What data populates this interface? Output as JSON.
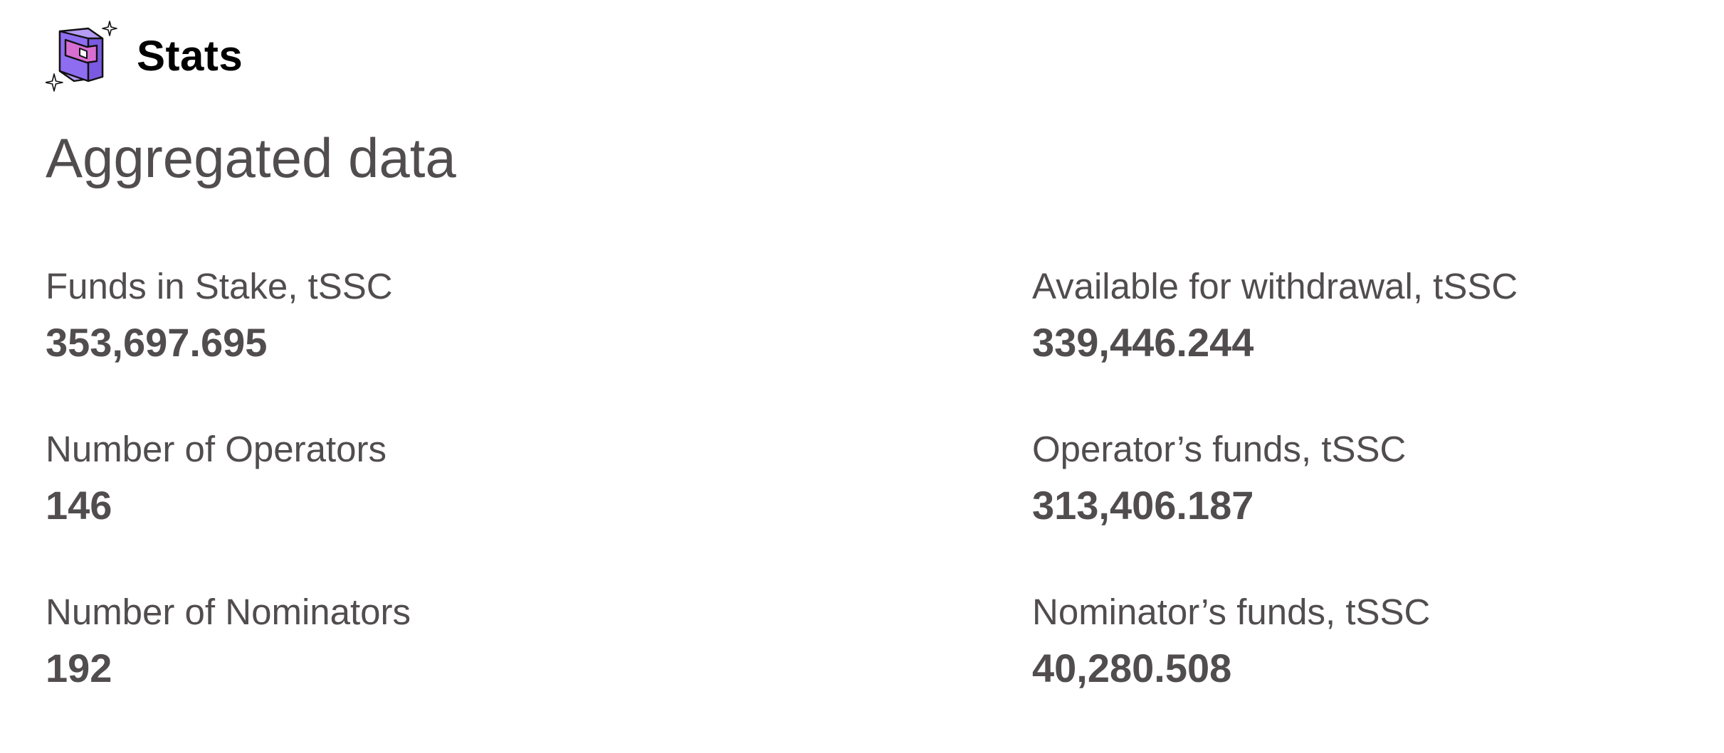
{
  "header": {
    "logo_icon": "wallet-icon",
    "title": "Stats"
  },
  "section": {
    "title": "Aggregated data"
  },
  "stats": [
    {
      "label": "Funds in Stake, tSSC",
      "value": "353,697.695"
    },
    {
      "label": "Available for withdrawal, tSSC",
      "value": "339,446.244"
    },
    {
      "label": "Number of Operators",
      "value": "146"
    },
    {
      "label": "Operator’s funds, tSSC",
      "value": "313,406.187"
    },
    {
      "label": "Number of Nominators",
      "value": "192"
    },
    {
      "label": "Nominator’s funds, tSSC",
      "value": "40,280.508"
    }
  ],
  "colors": {
    "text": "#514d4f",
    "title": "#000000",
    "logo_primary": "#9b7af0",
    "logo_accent": "#d05fc6"
  }
}
